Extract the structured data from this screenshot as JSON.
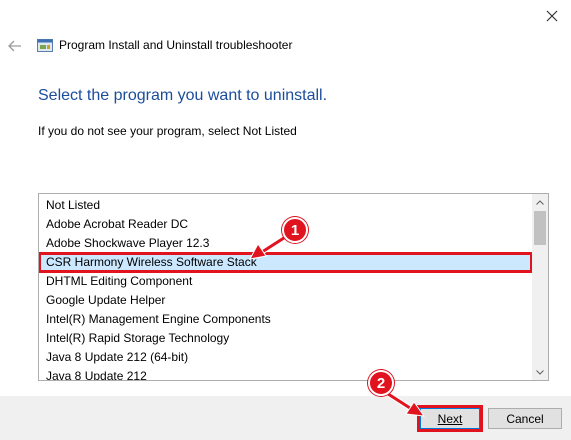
{
  "window": {
    "title": "Program Install and Uninstall troubleshooter"
  },
  "page": {
    "heading": "Select the program you want to uninstall.",
    "instruction": "If you do not see your program, select Not Listed"
  },
  "program_list": {
    "items": [
      "Not Listed",
      "Adobe Acrobat Reader DC",
      "Adobe Shockwave Player 12.3",
      "CSR Harmony Wireless Software Stack",
      "DHTML Editing Component",
      "Google Update Helper",
      "Intel(R) Management Engine Components",
      "Intel(R) Rapid Storage Technology",
      "Java 8 Update 212 (64-bit)",
      "Java 8 Update 212"
    ],
    "selected": "CSR Harmony Wireless Software Stack"
  },
  "buttons": {
    "next_label": "Next",
    "cancel_label": "Cancel"
  },
  "annotations": {
    "marker_1": "1",
    "marker_2": "2",
    "color": "#e0131f"
  },
  "icons": {
    "close": "close-icon",
    "back": "back-arrow-icon",
    "app": "troubleshooter-icon"
  },
  "colors": {
    "heading": "#1b4d9c",
    "selection": "#cce8ff",
    "highlight": "#e0131f"
  }
}
